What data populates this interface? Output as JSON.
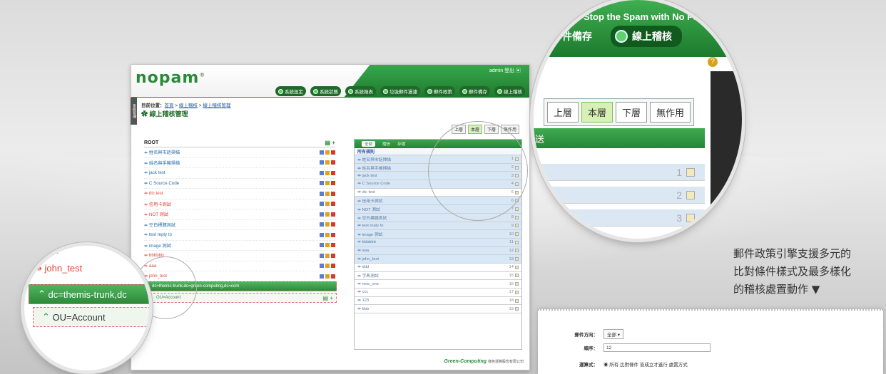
{
  "app": {
    "logo": "nopam",
    "admin_line": "admin 登出 ▣",
    "nav": [
      "系統設定",
      "系統狀態",
      "系統報表",
      "垃圾郵件過濾",
      "郵件政策",
      "郵件備存",
      "線上稽核"
    ],
    "side_tab": "系統管理",
    "breadcrumb_prefix": "目前位置：",
    "breadcrumb": [
      "首頁",
      "線上稽核",
      "線上稽核管理"
    ],
    "page_title": "線上稽核管理",
    "levels": [
      "上層",
      "本層",
      "下層",
      "無作用"
    ],
    "active_level": "本層",
    "tree_root": "ROOT",
    "tree_items": [
      {
        "label": "姓名與市話掃描",
        "red": false
      },
      {
        "label": "姓名與手機掃描",
        "red": false
      },
      {
        "label": "jack test",
        "red": false
      },
      {
        "label": "C Source Code",
        "red": false
      },
      {
        "label": "dic test",
        "red": true
      },
      {
        "label": "信用卡測試",
        "red": true
      },
      {
        "label": "NOT 測試",
        "red": true
      },
      {
        "label": "空白標題測試",
        "red": false
      },
      {
        "label": "test reply to",
        "red": false
      },
      {
        "label": "image 測試",
        "red": false
      },
      {
        "label": "bbbbbb",
        "red": true
      },
      {
        "label": "aaa",
        "red": true
      },
      {
        "label": "john_test",
        "red": true
      }
    ],
    "dc_row": "dc=themis-trunk,dc=green-computing,dc=com",
    "ou_row": "OU=Account",
    "rule_tabs": [
      "全部",
      "擋信",
      "存檔"
    ],
    "rule_caption": "所有規則",
    "rules": [
      {
        "name": "姓名與市話掃描",
        "n": "1",
        "hl": true
      },
      {
        "name": "姓名與手機掃描",
        "n": "2",
        "hl": true
      },
      {
        "name": "jack test",
        "n": "3",
        "hl": true
      },
      {
        "name": "C Source Code",
        "n": "4",
        "hl": true
      },
      {
        "name": "dic test",
        "n": "5",
        "hl": false
      },
      {
        "name": "信用卡測試",
        "n": "6",
        "hl": true
      },
      {
        "name": "NOT 測試",
        "n": "7",
        "hl": true
      },
      {
        "name": "空白標題測試",
        "n": "8",
        "hl": true
      },
      {
        "name": "test reply to",
        "n": "9",
        "hl": true
      },
      {
        "name": "image 測試",
        "n": "10",
        "hl": true
      },
      {
        "name": "bbbbbb",
        "n": "11",
        "hl": true
      },
      {
        "name": "aaa",
        "n": "12",
        "hl": true
      },
      {
        "name": "john_test",
        "n": "13",
        "hl": true
      },
      {
        "name": "ddd",
        "n": "14",
        "hl": false
      },
      {
        "name": "字典測試",
        "n": "15",
        "hl": false
      },
      {
        "name": "new_one",
        "n": "16",
        "hl": false
      },
      {
        "name": "ccc",
        "n": "17",
        "hl": false
      },
      {
        "name": "123",
        "n": "18",
        "hl": false
      },
      {
        "name": "bbb",
        "n": "19",
        "hl": false
      }
    ],
    "footer_brand": "Green-Computing",
    "footer_company": "綠色運算股份有限公司"
  },
  "mag_right": {
    "slogan": "Stop the Spam with No Pain",
    "menu_archive": "件備存",
    "menu_audit": "線上稽核",
    "help": "?",
    "levels": [
      "上層",
      "本層",
      "下層",
      "無作用"
    ],
    "active_level": "本層",
    "side_text": "送",
    "rows": [
      "1",
      "2",
      "3"
    ]
  },
  "mag_left": {
    "item_aaa": "aaa",
    "item_john": "john_test",
    "dc": "dc=themis-trunk,dc",
    "ou": "OU=Account"
  },
  "caption": {
    "line1": "郵件政策引擎支援多元的",
    "line2": "比對條件樣式及最多樣化",
    "line3": "的稽核處置動作 ▼"
  },
  "form": {
    "direction_label": "郵件方向：",
    "direction_value": "全部 ▾",
    "order_label": "順序：",
    "order_value": "12",
    "mode_label": "運算式：",
    "mode_value": "◉ 所有 比對條件 皆成立才進行 處置方式"
  }
}
